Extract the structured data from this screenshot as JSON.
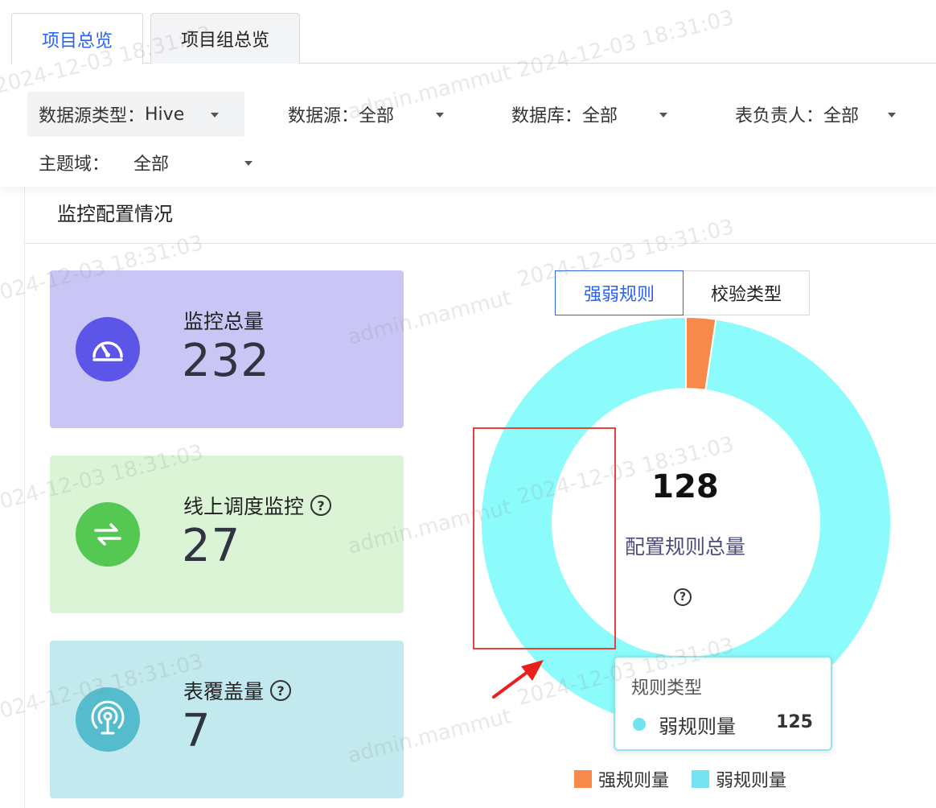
{
  "tabs": [
    {
      "label": "项目总览",
      "active": true
    },
    {
      "label": "项目组总览",
      "active": false
    }
  ],
  "filters": {
    "datasource_type": {
      "label": "数据源类型：",
      "value": "Hive"
    },
    "datasource": {
      "label": "数据源：",
      "value": "全部"
    },
    "database": {
      "label": "数据库：",
      "value": "全部"
    },
    "table_owner": {
      "label": "表负责人：",
      "value": "全部"
    },
    "topic_domain": {
      "label": "主题域：",
      "value": "全部"
    }
  },
  "section": {
    "title": "监控配置情况"
  },
  "cards": [
    {
      "label": "监控总量",
      "value": "232",
      "color": "#c9c6f5",
      "icon": "gauge-icon"
    },
    {
      "label": "线上调度监控",
      "value": "27",
      "color": "#dbf4d6",
      "icon": "swap-arrows-icon"
    },
    {
      "label": "表覆盖量",
      "value": "7",
      "color": "#c2e9ee",
      "icon": "broadcast-icon"
    }
  ],
  "chart_toggle": {
    "options": [
      "强弱规则",
      "校验类型"
    ],
    "selected": "强弱规则"
  },
  "chart_data": {
    "type": "pie",
    "donut": true,
    "center_value": "128",
    "center_label": "配置规则总量",
    "series": [
      {
        "name": "强规则量",
        "value": 3,
        "color": "#f7894a"
      },
      {
        "name": "弱规则量",
        "value": 125,
        "color": "#8bfbfc"
      }
    ],
    "legend_position": "bottom"
  },
  "tooltip": {
    "title": "规则类型",
    "name": "弱规则量",
    "value": "125"
  },
  "watermark": {
    "time": "2024-12-03 18:31:03",
    "user": "admin.mammut"
  }
}
